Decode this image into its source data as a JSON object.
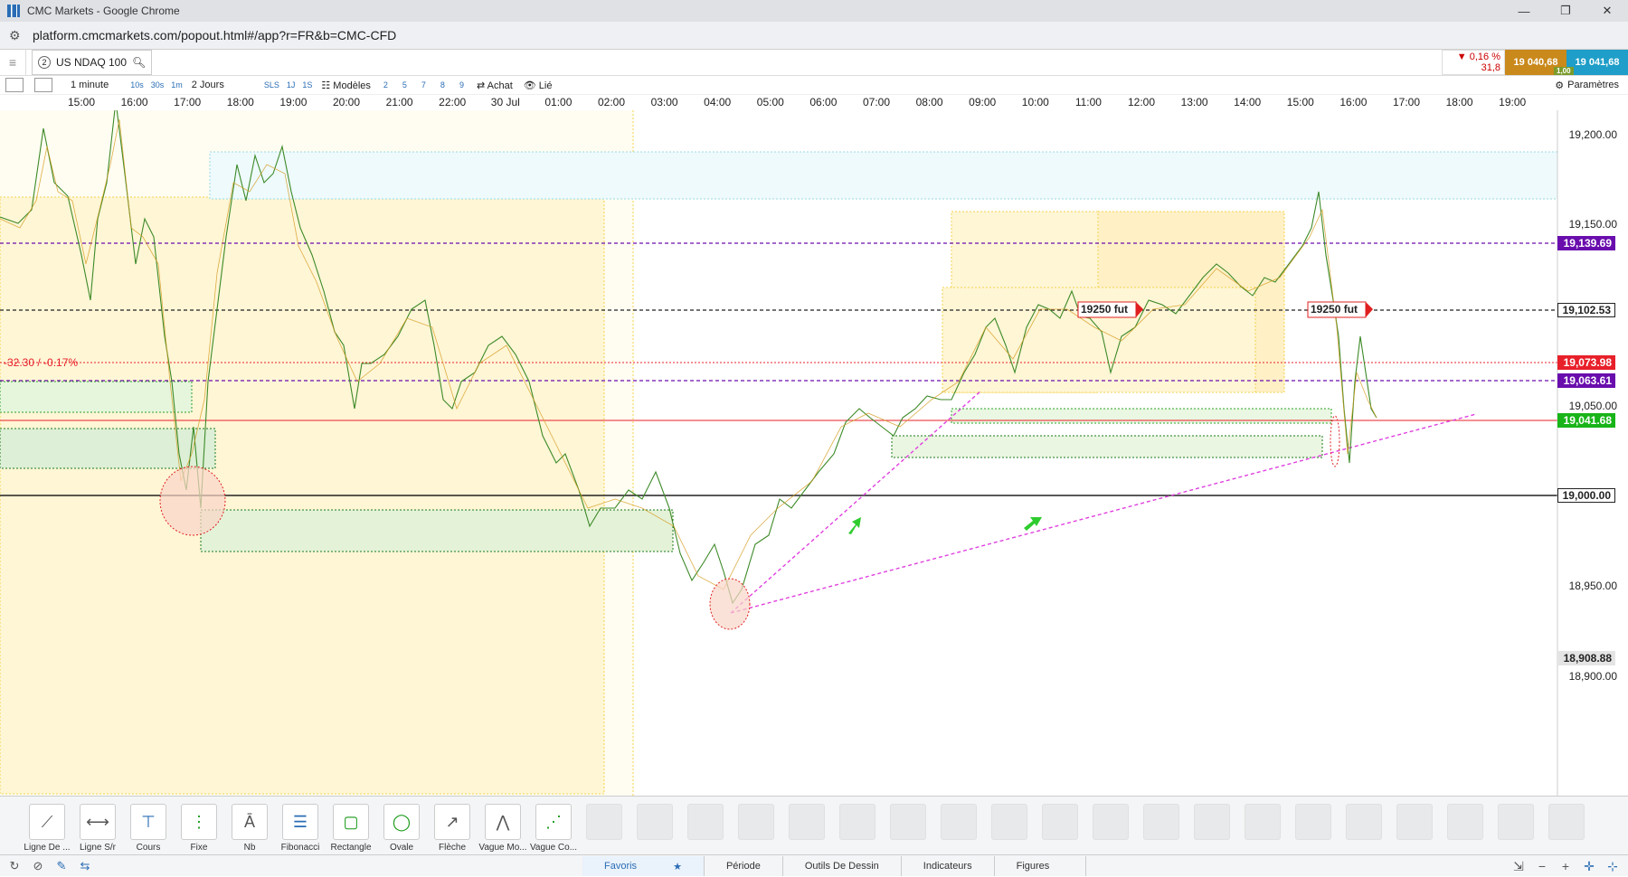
{
  "window": {
    "title": "CMC Markets - Google Chrome",
    "url": "platform.cmcmarkets.com/popout.html#/app?r=FR&b=CMC-CFD"
  },
  "instrument": {
    "number": "2",
    "name": "US NDAQ 100"
  },
  "quote": {
    "change_pct": "▼ 0,16 %",
    "change_pts": "31,8",
    "sell": "19 040,68",
    "buy": "19 041,68",
    "spread": "1,00"
  },
  "toolbar": {
    "interval": "1 minute",
    "intervals": [
      "10s",
      "30s",
      "1m"
    ],
    "period": "2 Jours",
    "sls": "SLS",
    "periods": [
      "1J",
      "1S"
    ],
    "models": "Modèles",
    "model_nums": [
      "2",
      "5",
      "7",
      "8",
      "9"
    ],
    "buy": "Achat",
    "linked": "Lié",
    "settings": "Paramètres"
  },
  "time_labels": [
    "15:00",
    "16:00",
    "17:00",
    "18:00",
    "19:00",
    "20:00",
    "21:00",
    "22:00",
    "30 Jul",
    "01:00",
    "02:00",
    "03:00",
    "04:00",
    "05:00",
    "06:00",
    "07:00",
    "08:00",
    "09:00",
    "10:00",
    "11:00",
    "12:00",
    "13:00",
    "14:00",
    "15:00",
    "16:00",
    "17:00",
    "18:00",
    "19:00"
  ],
  "price_labels": [
    "19,200.00",
    "19,150.00",
    "19,050.00",
    "18,950.00",
    "18,900.00"
  ],
  "tags": {
    "purple1": "19,139.69",
    "black1": "19,102.53",
    "red": "19,073.98",
    "purple2": "19,063.61",
    "green": "19,041.68",
    "zero": "19,000.00",
    "low": "18,908.88"
  },
  "annotations": {
    "change_label": "-32.30 / -0.17%",
    "fut1": "19250 fut",
    "fut2": "19250 fut"
  },
  "tools": [
    {
      "label": "Ligne De ...",
      "icon": "line-icon"
    },
    {
      "label": "Ligne S/r",
      "icon": "sr-line-icon"
    },
    {
      "label": "Cours",
      "icon": "price-icon"
    },
    {
      "label": "Fixe",
      "icon": "fixed-icon"
    },
    {
      "label": "Nb",
      "icon": "text-icon"
    },
    {
      "label": "Fibonacci",
      "icon": "fibonacci-icon"
    },
    {
      "label": "Rectangle",
      "icon": "rectangle-icon"
    },
    {
      "label": "Ovale",
      "icon": "oval-icon"
    },
    {
      "label": "Flèche",
      "icon": "arrow-icon"
    },
    {
      "label": "Vague Mo...",
      "icon": "wave-icon"
    },
    {
      "label": "Vague Co...",
      "icon": "wave2-icon"
    }
  ],
  "tabs": [
    "Favoris",
    "Période",
    "Outils De Dessin",
    "Indicateurs",
    "Figures"
  ],
  "colors": {
    "purple": "#6a0dad",
    "red": "#e8202a",
    "green": "#18b418",
    "sell": "#c9891b",
    "buy": "#1e9ec8"
  }
}
